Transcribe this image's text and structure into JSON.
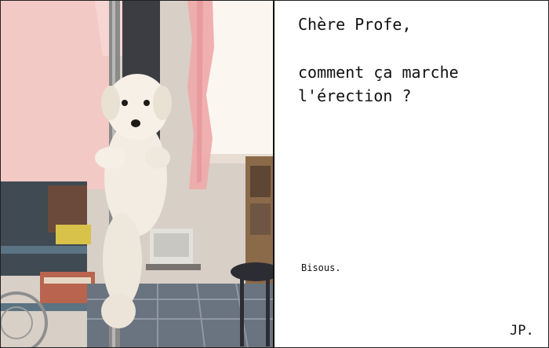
{
  "card": {
    "greeting": "Chère Profe,",
    "question_line1": "comment ça marche",
    "question_line2": "l'érection ?",
    "closing": "Bisous.",
    "signature": "JP."
  },
  "photo": {
    "subject": "small white fluffy dog clinging to a vertical pole",
    "accent_colors": {
      "shirt": "#f3c9c6",
      "curtain": "#f0a8a8",
      "pole": "#8a8a88",
      "dog": "#f2ece2",
      "window": "#fbf6f0"
    }
  }
}
